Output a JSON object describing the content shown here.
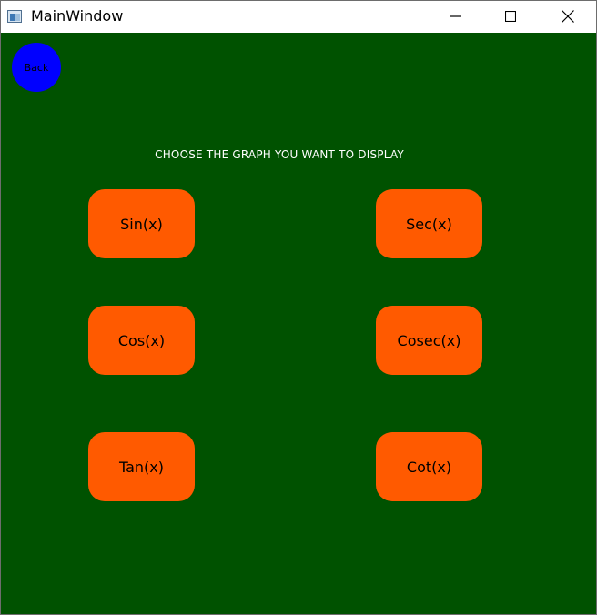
{
  "window": {
    "title": "MainWindow",
    "icon": "app-window-icon",
    "controls": [
      "minimize-icon",
      "maximize-icon",
      "close-icon"
    ]
  },
  "back": {
    "label": "Back",
    "color": "#0000ff"
  },
  "prompt": "CHOOSE THE GRAPH YOU WANT TO DISPLAY",
  "graphs": {
    "sin": "Sin(x)",
    "cos": "Cos(x)",
    "tan": "Tan(x)",
    "sec": "Sec(x)",
    "cosec": "Cosec(x)",
    "cot": "Cot(x)"
  },
  "colors": {
    "background": "#005200",
    "button": "#ff5a00",
    "back_button": "#0000ff"
  }
}
